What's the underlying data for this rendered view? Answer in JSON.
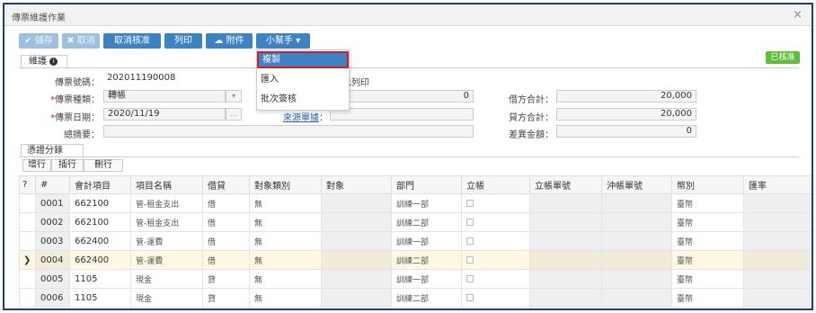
{
  "window": {
    "title": "傳票維護作業",
    "close_icon": "×"
  },
  "toolbar": {
    "save": "✔ 儲存",
    "cancel": "✖ 取消",
    "cancel_approve": "取消核准",
    "print": "列印",
    "attach": "附件",
    "helper": "小幫手 ▾"
  },
  "helper_menu": {
    "items": [
      "複製",
      "匯入",
      "批次簽核"
    ],
    "selected_index": 0
  },
  "tabs": {
    "main": "維護",
    "sub": "憑證分錄"
  },
  "status_badge": "已核准",
  "form": {
    "voucher_no_label": "傳票號碼：",
    "voucher_no": "202011190008",
    "printed_text": "已列印",
    "voucher_type_label": "傳票種類：",
    "voucher_type": "轉帳",
    "voucher_date_label": "傳票日期：",
    "voucher_date": "2020/11/19",
    "summary_label": "總摘要：",
    "summary": "",
    "count_value": "0",
    "source_link": "來源單據",
    "source_colon": "：",
    "source_value": "",
    "debit_total_label": "借方合計：",
    "debit_total": "20,000",
    "credit_total_label": "貸方合計：",
    "credit_total": "20,000",
    "diff_label": "差異金額：",
    "diff": "0"
  },
  "row_buttons": [
    "增行",
    "插行",
    "刪行"
  ],
  "grid": {
    "headers": [
      "#",
      "會計項目",
      "項目名稱",
      "借貸",
      "對象類別",
      "對象",
      "部門",
      "立帳",
      "立帳單號",
      "沖帳單號",
      "幣別",
      "匯率"
    ],
    "rows": [
      {
        "no": "0001",
        "acct": "662100",
        "name": "管-租金支出",
        "dc": "借",
        "obj_type": "無",
        "obj": "",
        "dept": "訓練一部",
        "currency": "臺幣"
      },
      {
        "no": "0002",
        "acct": "662100",
        "name": "管-租金支出",
        "dc": "借",
        "obj_type": "無",
        "obj": "",
        "dept": "訓練二部",
        "currency": "臺幣"
      },
      {
        "no": "0003",
        "acct": "662400",
        "name": "管-運費",
        "dc": "借",
        "obj_type": "無",
        "obj": "",
        "dept": "訓練一部",
        "currency": "臺幣"
      },
      {
        "no": "0004",
        "acct": "662400",
        "name": "管-運費",
        "dc": "借",
        "obj_type": "無",
        "obj": "",
        "dept": "訓練二部",
        "currency": "臺幣"
      },
      {
        "no": "0005",
        "acct": "1105",
        "name": "現金",
        "dc": "貸",
        "obj_type": "無",
        "obj": "",
        "dept": "訓練一部",
        "currency": "臺幣"
      },
      {
        "no": "0006",
        "acct": "1105",
        "name": "現金",
        "dc": "貸",
        "obj_type": "無",
        "obj": "",
        "dept": "訓練二部",
        "currency": "臺幣"
      }
    ],
    "active_row_marker": "❯"
  },
  "colors": {
    "primary": "#3d82c4",
    "badge": "#5fbf3a",
    "highlight_border": "#d62020",
    "active_row": "#fdf7e3"
  }
}
